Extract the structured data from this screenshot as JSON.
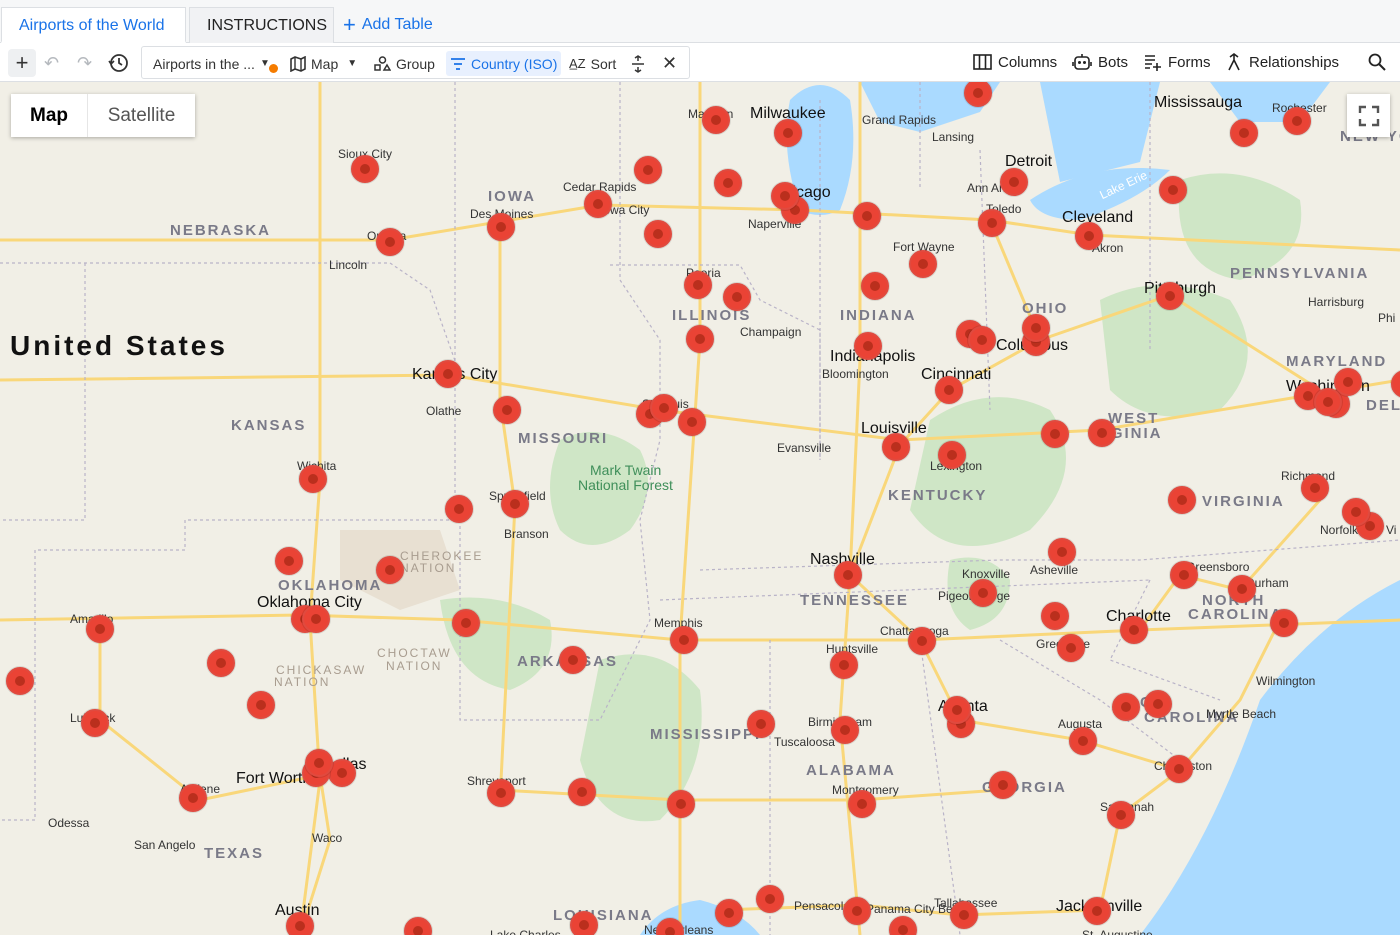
{
  "tabs": [
    {
      "label": "Airports of the World",
      "active": true
    },
    {
      "label": "INSTRUCTIONS",
      "active": false
    }
  ],
  "add_table": "Add Table",
  "toolbar": {
    "view_name": "Airports in the ...",
    "view_type": "Map",
    "group": "Group",
    "filter": "Country (ISO)",
    "sort": "Sort",
    "columns": "Columns",
    "bots": "Bots",
    "forms": "Forms",
    "relationships": "Relationships"
  },
  "map_type": {
    "map": "Map",
    "satellite": "Satellite",
    "selected": "Map"
  },
  "map_labels": {
    "country": "United States",
    "states": [
      "NEBRASKA",
      "IOWA",
      "ILLINOIS",
      "INDIANA",
      "OHIO",
      "PENNSYLVANIA",
      "MARYLAND",
      "KANSAS",
      "MISSOURI",
      "KENTUCKY",
      "WEST",
      "RGINIA",
      "VIRGINIA",
      "TENNESSEE",
      "NORTH",
      "CAROLINA",
      "OKLAHOMA",
      "ARKANSAS",
      "MISSISSIPPI",
      "ALABAMA",
      "GEORGIA",
      "TEXAS",
      "LOUISIANA",
      "CH",
      "CAROLINA",
      "DEL",
      "NEW YO"
    ],
    "cities": [
      "Sioux City",
      "Omaha",
      "Lincoln",
      "Des Moines",
      "Cedar Rapids",
      "Iowa City",
      "Madison",
      "Milwaukee",
      "Grand Rapids",
      "Lansing",
      "Detroit",
      "Ann Arbor",
      "Toledo",
      "Cleveland",
      "Akron",
      "Mississauga",
      "Rochester",
      "Chicago",
      "Naperville",
      "Fort Wayne",
      "Peoria",
      "Champaign",
      "Indianapolis",
      "Bloomington",
      "Columbus",
      "Cincinnati",
      "Pittsburgh",
      "Harrisburg",
      "Phi",
      "Washington",
      "Kansas City",
      "Olathe",
      "Wichita",
      "St. Louis",
      "Springfield",
      "Branson",
      "Evansville",
      "Louisville",
      "Lexington",
      "Richmond",
      "Norfolk",
      "Vi",
      "Mark Twain",
      "National Forest",
      "Nashville",
      "Knoxville",
      "Pigeon Forge",
      "Asheville",
      "Greensboro",
      "Durham",
      "Charlotte",
      "Greenville",
      "Chattanooga",
      "Huntsville",
      "Memphis",
      "Oklahoma City",
      "CHEROKEE",
      "NATION",
      "CHICKASAW",
      "NATION",
      "CHOCTAW",
      "NATION",
      "Amarillo",
      "Lubbock",
      "Fort Worth",
      "Dallas",
      "Abilene",
      "Odessa",
      "San Angelo",
      "Waco",
      "Austin",
      "Shreveport",
      "Birmingham",
      "Tuscaloosa",
      "Atlanta",
      "Augusta",
      "Wilmington",
      "Myrtle Beach",
      "Charleston",
      "Montgomery",
      "Savannah",
      "Pensacola",
      "Panama City Beach",
      "Tallahassee",
      "Jacksonville",
      "New Orleans",
      "Lake Charles",
      "St. Augustine",
      "Lake Erie"
    ]
  },
  "colors": {
    "accent": "#1a73e8",
    "marker": "#ea4335",
    "marker_dark": "#a52714",
    "water": "#aadaff",
    "park": "#c8e6c0",
    "road": "#f9d77a"
  },
  "markers": [
    {
      "city": "Sioux City"
    },
    {
      "city": "Omaha"
    },
    {
      "city": "Des Moines"
    },
    {
      "city": "Cedar Rapids"
    },
    {
      "city": "Madison"
    },
    {
      "city": "Milwaukee"
    },
    {
      "city": "Chicago"
    },
    {
      "city": "Detroit"
    },
    {
      "city": "Toledo"
    },
    {
      "city": "Cleveland"
    },
    {
      "city": "Rochester"
    },
    {
      "city": "Pittsburgh"
    },
    {
      "city": "Peoria"
    },
    {
      "city": "Indianapolis"
    },
    {
      "city": "Columbus"
    },
    {
      "city": "Cincinnati"
    },
    {
      "city": "Kansas City"
    },
    {
      "city": "St. Louis"
    },
    {
      "city": "Wichita"
    },
    {
      "city": "Springfield"
    },
    {
      "city": "Louisville"
    },
    {
      "city": "Lexington"
    },
    {
      "city": "Washington"
    },
    {
      "city": "Richmond"
    },
    {
      "city": "Norfolk"
    },
    {
      "city": "Nashville"
    },
    {
      "city": "Knoxville"
    },
    {
      "city": "Greensboro"
    },
    {
      "city": "Charlotte"
    },
    {
      "city": "Memphis"
    },
    {
      "city": "Oklahoma City"
    },
    {
      "city": "Amarillo"
    },
    {
      "city": "Lubbock"
    },
    {
      "city": "Dallas"
    },
    {
      "city": "Fort Worth"
    },
    {
      "city": "Abilene"
    },
    {
      "city": "Shreveport"
    },
    {
      "city": "Birmingham"
    },
    {
      "city": "Atlanta"
    },
    {
      "city": "Huntsville"
    },
    {
      "city": "Charleston"
    },
    {
      "city": "Savannah"
    },
    {
      "city": "Jacksonville"
    },
    {
      "city": "Pensacola"
    },
    {
      "city": "Tallahassee"
    },
    {
      "city": "New Orleans"
    },
    {
      "city": "Austin"
    },
    {
      "city": "Little Rock"
    }
  ]
}
